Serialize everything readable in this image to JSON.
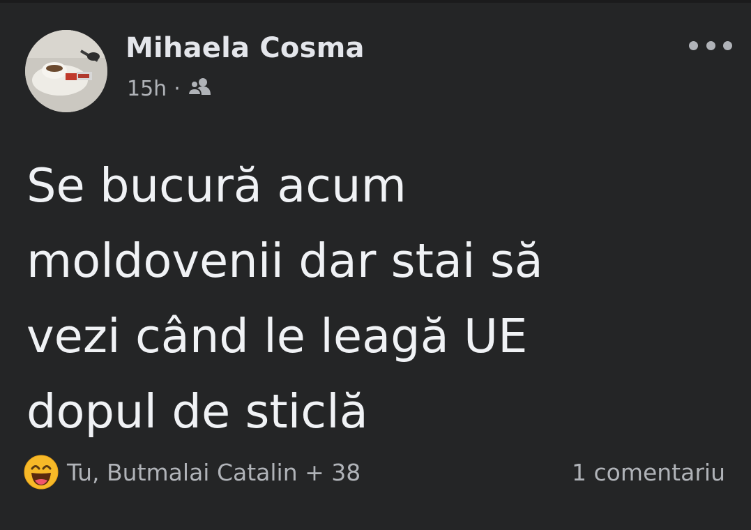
{
  "post": {
    "author": "Mihaela Cosma",
    "time": "15h",
    "separator": "·",
    "audience_icon": "friends-icon",
    "more_icon": "more-options-icon",
    "text_lines": [
      "Se bucură acum",
      "moldovenii dar stai să",
      "vezi când le leagă UE",
      "dopul de sticlă"
    ]
  },
  "footer": {
    "reaction_icon": "haha-reaction-icon",
    "reactions_text": "Tu, Butmalai Catalin + 38",
    "comments_text": "1 comentariu"
  },
  "colors": {
    "background": "#242526",
    "primary_text": "#e4e6eb",
    "secondary_text": "#b0b3b8",
    "reaction_yellow": "#f7b928"
  }
}
